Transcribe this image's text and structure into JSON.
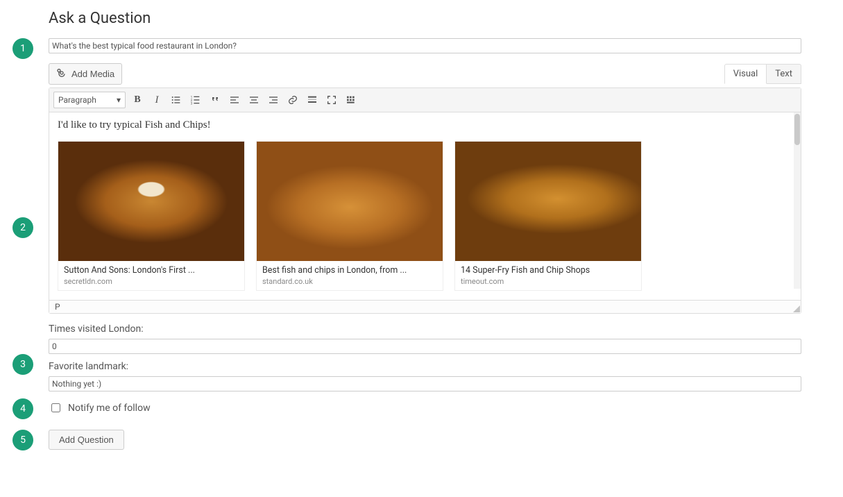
{
  "page": {
    "title": "Ask a Question"
  },
  "steps": [
    "1",
    "2",
    "3",
    "4",
    "5"
  ],
  "question": {
    "title_value": "What's the best typical food restaurant in London?"
  },
  "editor": {
    "add_media_label": "Add Media",
    "tabs": {
      "visual": "Visual",
      "text": "Text",
      "active": "visual"
    },
    "paragraph_label": "Paragraph",
    "body_text": "I'd like to try typical Fish and Chips!",
    "status_path": "P",
    "images": [
      {
        "caption": "Sutton And Sons: London's First ...",
        "source": "secretldn.com"
      },
      {
        "caption": "Best fish and chips in London, from ...",
        "source": "standard.co.uk"
      },
      {
        "caption": "14 Super-Fry Fish and Chip Shops",
        "source": "timeout.com"
      }
    ]
  },
  "fields": {
    "visits": {
      "label": "Times visited London:",
      "value": "0"
    },
    "landmark": {
      "label": "Favorite landmark:",
      "value": "Nothing yet :)"
    },
    "notify": {
      "label": "Notify me of follow",
      "checked": false
    }
  },
  "submit": {
    "label": "Add Question"
  }
}
